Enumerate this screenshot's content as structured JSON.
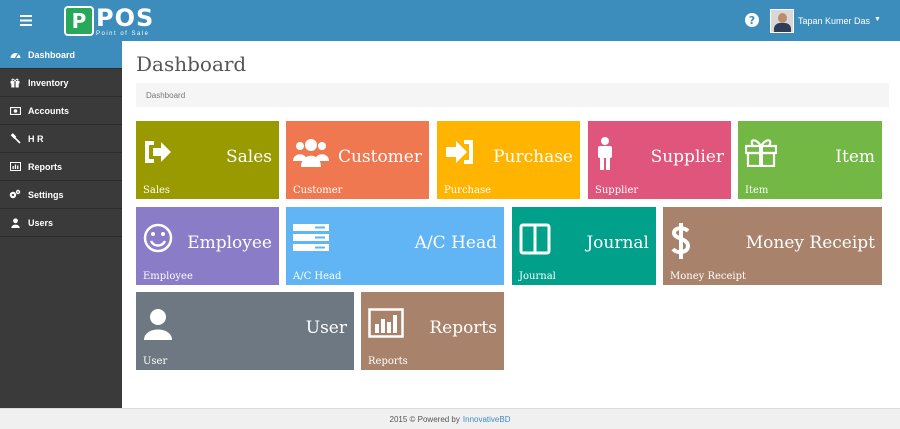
{
  "header": {
    "logo_letter": "P",
    "logo_text": "POS",
    "logo_subtext": "Point of Sale",
    "help_glyph": "?",
    "user_name": "Tapan Kumer Das"
  },
  "sidebar": {
    "items": [
      {
        "label": "Dashboard",
        "icon": "dashboard-icon",
        "active": true
      },
      {
        "label": "Inventory",
        "icon": "gift-icon",
        "active": false
      },
      {
        "label": "Accounts",
        "icon": "money-icon",
        "active": false
      },
      {
        "label": "H R",
        "icon": "gavel-icon",
        "active": false
      },
      {
        "label": "Reports",
        "icon": "bar-chart-icon",
        "active": false
      },
      {
        "label": "Settings",
        "icon": "cogs-icon",
        "active": false
      },
      {
        "label": "Users",
        "icon": "user-icon",
        "active": false
      }
    ]
  },
  "main": {
    "title": "Dashboard",
    "breadcrumb": "Dashboard",
    "tiles": [
      {
        "title": "Sales",
        "sub": "Sales",
        "color": "#999900",
        "icon": "sign-in-arrow-icon"
      },
      {
        "title": "Customer",
        "sub": "Customer",
        "color": "#f07850",
        "icon": "users-icon"
      },
      {
        "title": "Purchase",
        "sub": "Purchase",
        "color": "#ffb500",
        "icon": "sign-in-icon"
      },
      {
        "title": "Supplier",
        "sub": "Supplier",
        "color": "#e0557b",
        "icon": "male-icon"
      },
      {
        "title": "Item",
        "sub": "Item",
        "color": "#73b744",
        "icon": "gift-icon"
      },
      {
        "title": "Employee",
        "sub": "Employee",
        "color": "#8a7cc6",
        "icon": "smile-icon"
      },
      {
        "title": "A/C Head",
        "sub": "A/C Head",
        "color": "#61b5f5",
        "icon": "server-icon"
      },
      {
        "title": "Journal",
        "sub": "Journal",
        "color": "#00a08a",
        "icon": "columns-icon"
      },
      {
        "title": "Money Receipt",
        "sub": "Money Receipt",
        "color": "#a8826a",
        "icon": "dollar-icon"
      },
      {
        "title": "User",
        "sub": "User",
        "color": "#6e7882",
        "icon": "user-icon"
      },
      {
        "title": "Reports",
        "sub": "Reports",
        "color": "#a8826a",
        "icon": "bar-chart-icon"
      }
    ]
  },
  "footer": {
    "text": "2015 © Powered by",
    "link": "InnovativeBD"
  }
}
